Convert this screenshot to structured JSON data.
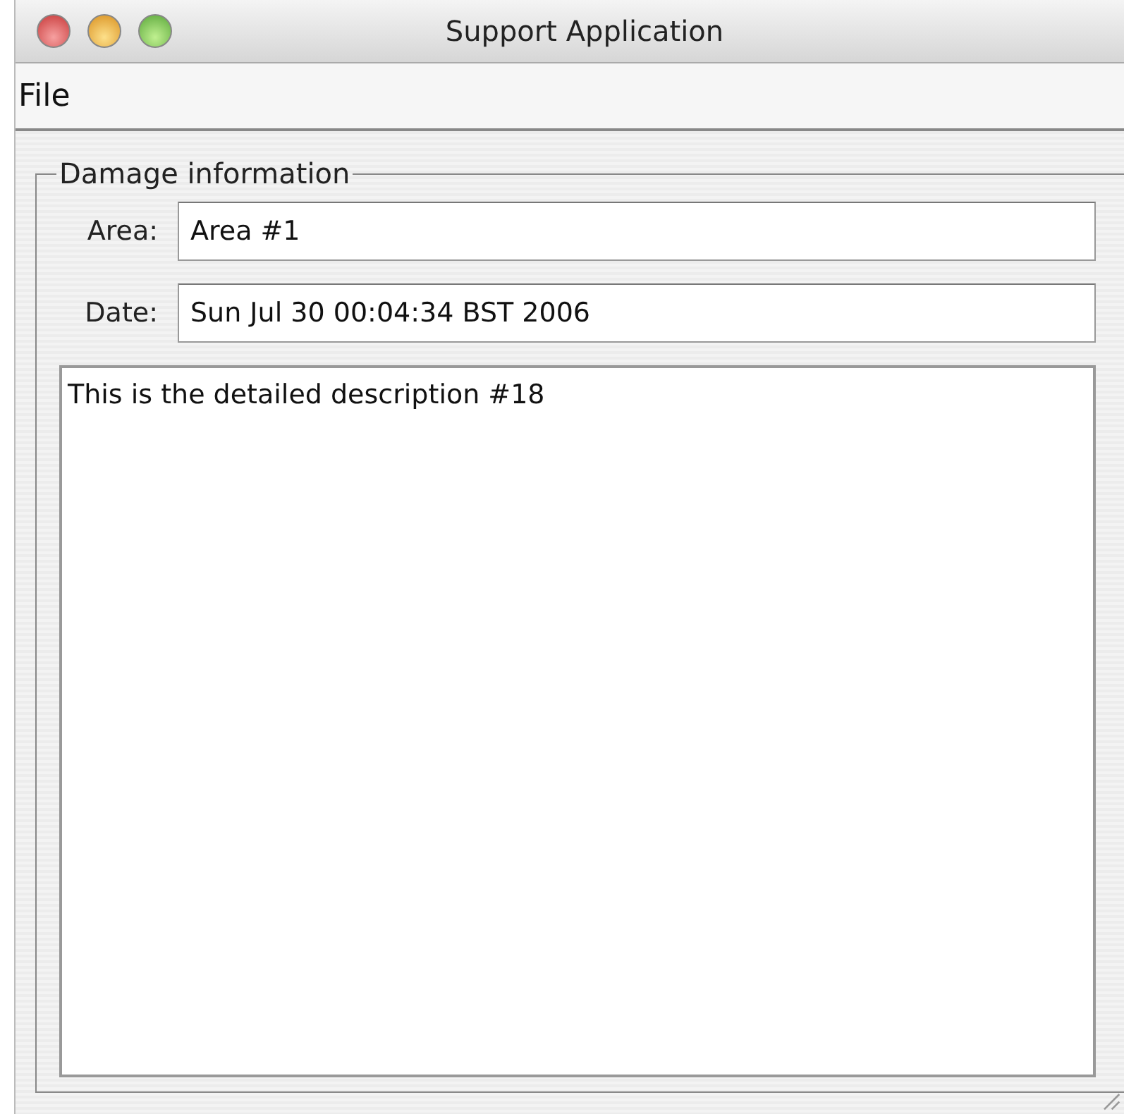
{
  "window": {
    "title": "Support Application"
  },
  "menu": [
    "File"
  ],
  "group": {
    "title": "Damage information",
    "fields": [
      {
        "label": "Area:",
        "value": "Area #1"
      },
      {
        "label": "Date:",
        "value": "Sun Jul 30 00:04:34 BST 2006"
      }
    ],
    "description": "This is the detailed description #18"
  }
}
